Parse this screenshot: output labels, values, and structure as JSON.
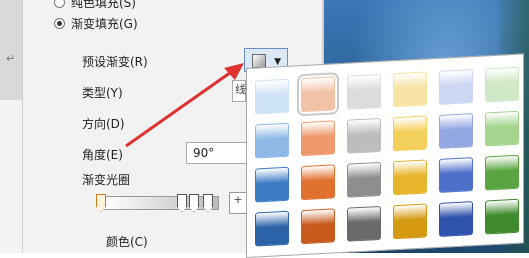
{
  "fill_options": {
    "solid_fill_label": "纯色填充(S)",
    "gradient_fill_label": "渐变填充(G)"
  },
  "gradient": {
    "preset_label": "预设渐变(R)",
    "type_label": "类型(Y)",
    "type_value": "线",
    "direction_label": "方向(D)",
    "angle_label": "角度(E)",
    "angle_value": "90°",
    "stops_label": "渐变光圈",
    "color_label": "颜色(C)"
  },
  "document": {
    "paragraph_mark": "↵"
  },
  "icons": {
    "dropdown_arrow": "▼",
    "add_stop": "+"
  },
  "preset_gallery": {
    "rows": [
      [
        "#cfe3f7",
        "#f2c2a6",
        "#dcdcdc",
        "#f7e3a3",
        "#cdd7f3",
        "#cfe8c6"
      ],
      [
        "#8fb8e6",
        "#ef9a6c",
        "#bdbdbd",
        "#f3cf5b",
        "#93a8e3",
        "#a3d58f"
      ],
      [
        "#3d7cc5",
        "#e0712f",
        "#8e8e8e",
        "#e7b52c",
        "#4d6fc9",
        "#5aa442"
      ],
      [
        "#2b63a8",
        "#c85a1d",
        "#6a6a6a",
        "#d49a12",
        "#2f52ad",
        "#3f8a2c"
      ]
    ]
  }
}
